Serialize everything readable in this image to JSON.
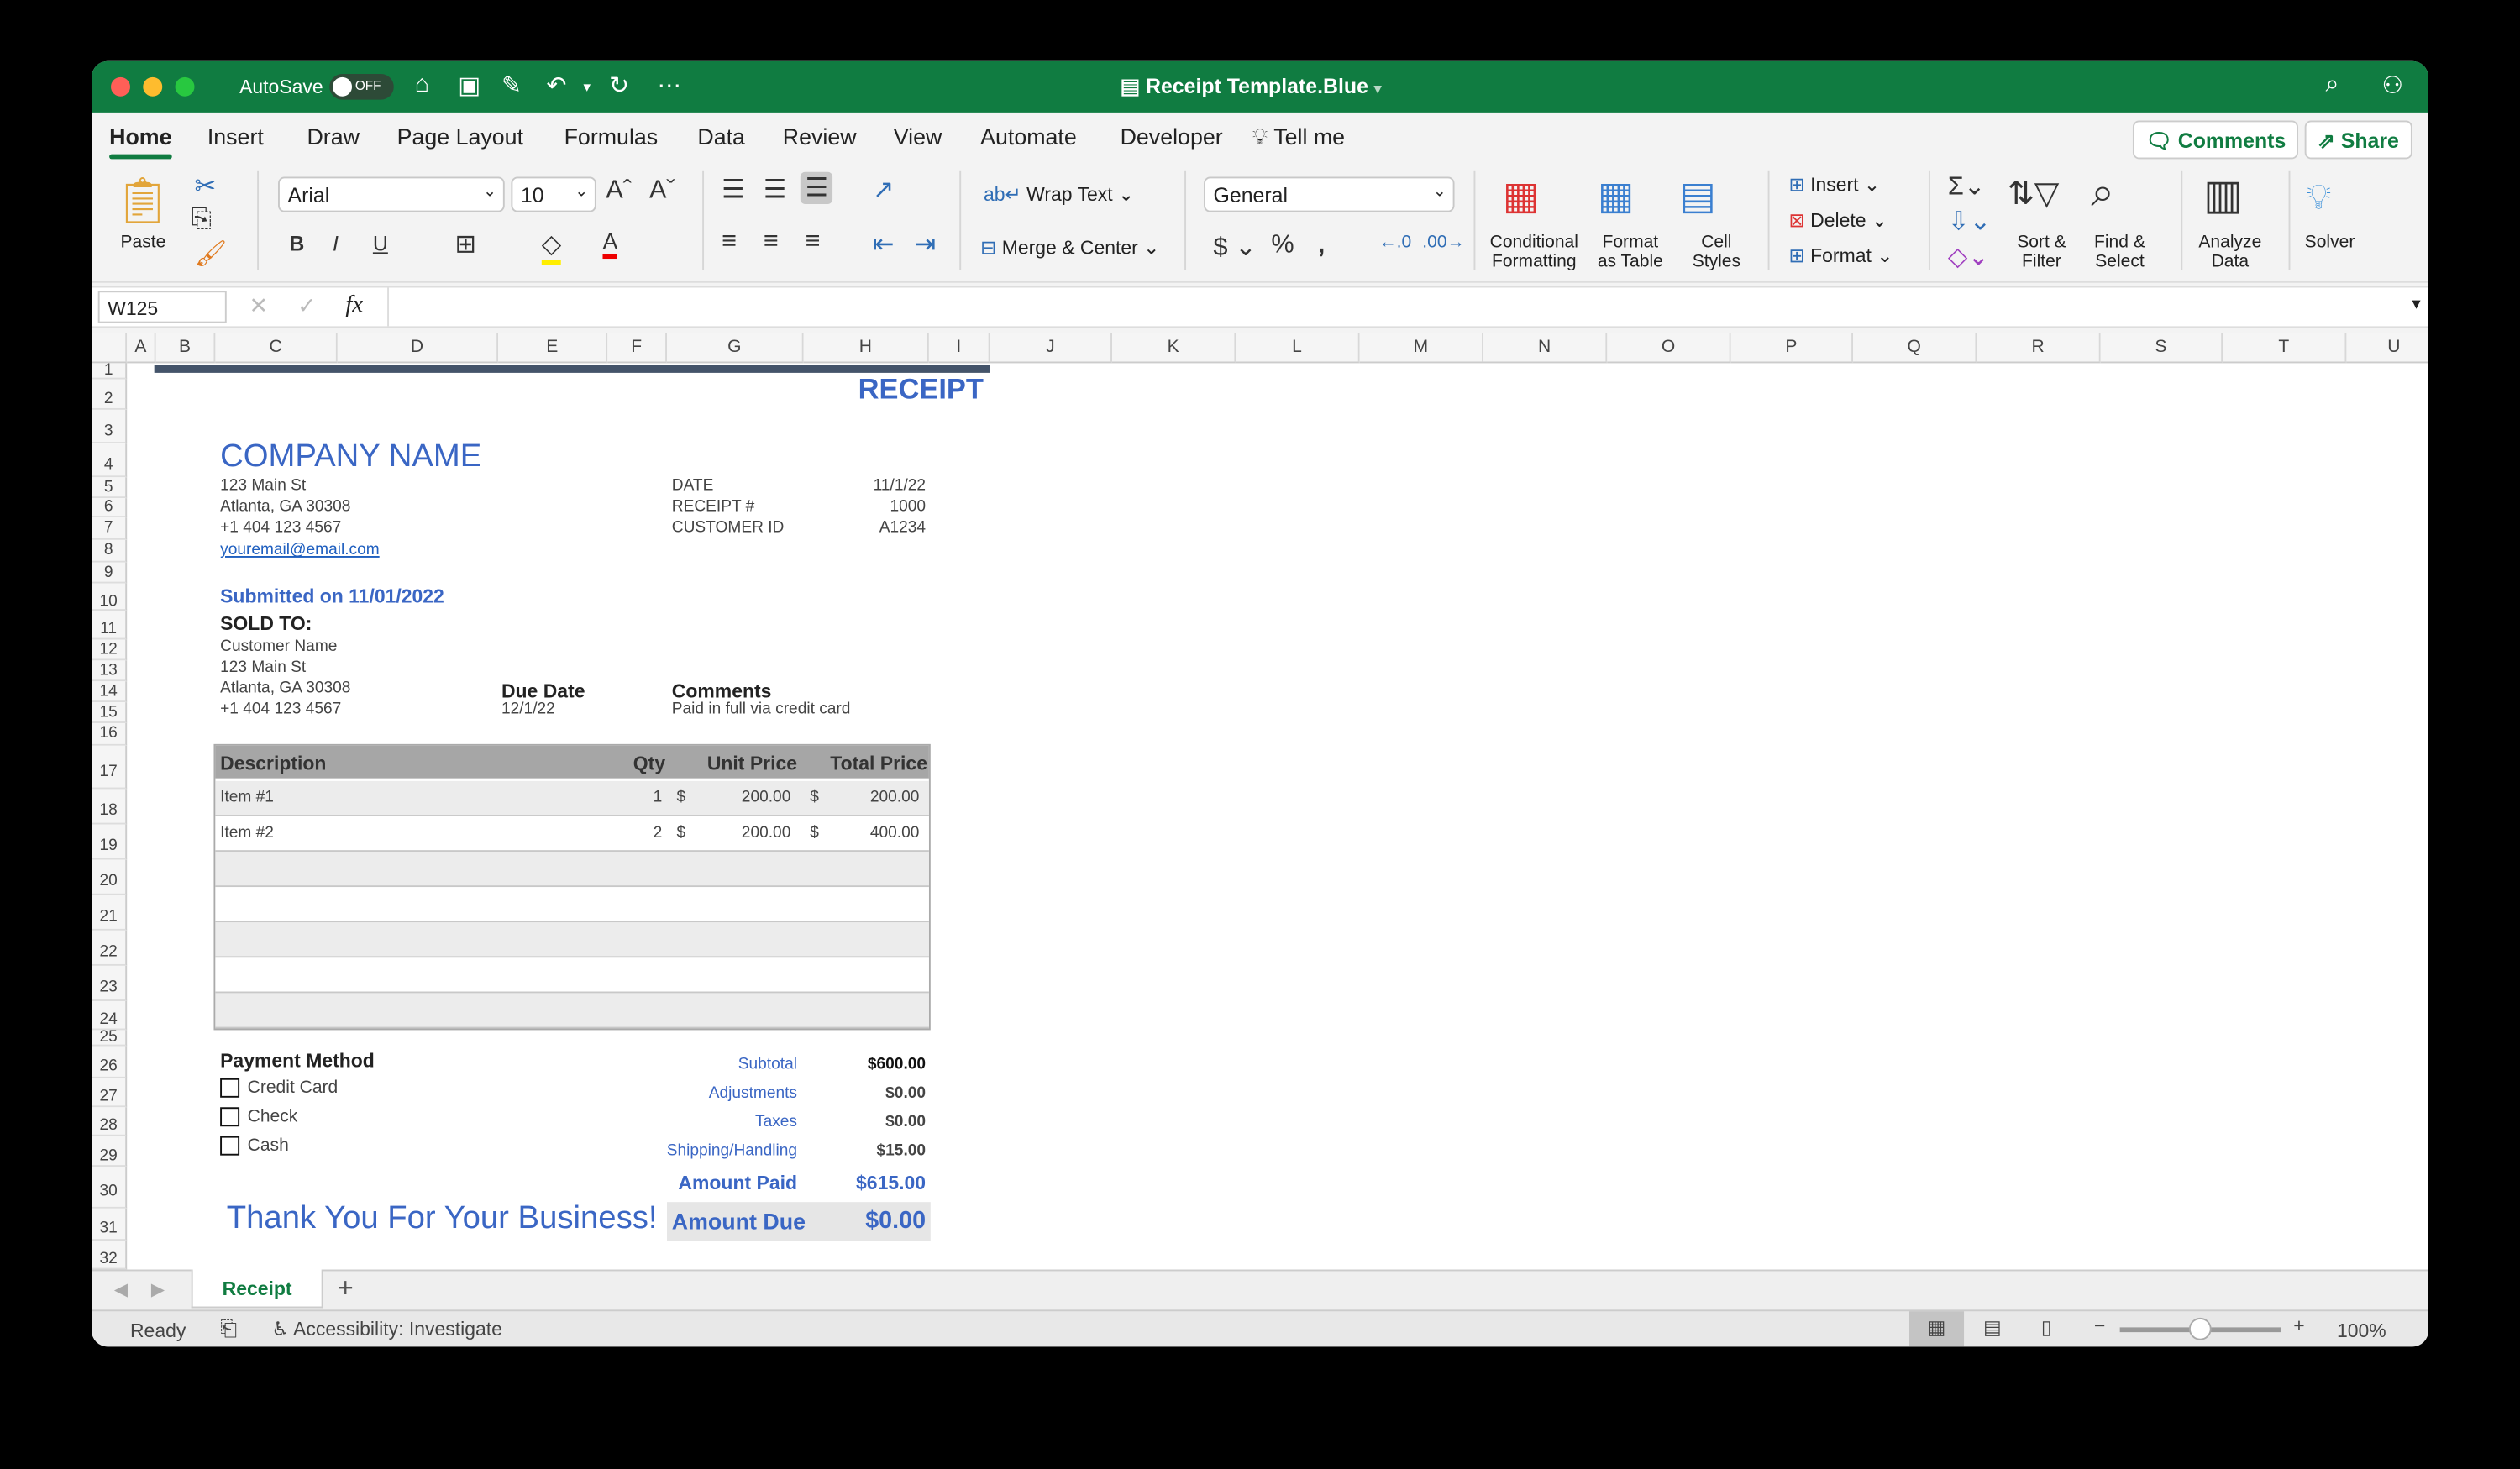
{
  "titlebar": {
    "autosave": "AutoSave",
    "autosave_state": "OFF",
    "doc_title": "Receipt Template.Blue"
  },
  "tabs": [
    "Home",
    "Insert",
    "Draw",
    "Page Layout",
    "Formulas",
    "Data",
    "Review",
    "View",
    "Automate",
    "Developer"
  ],
  "tell_me": "Tell me",
  "comments": "Comments",
  "share": "Share",
  "ribbon": {
    "paste": "Paste",
    "font": "Arial",
    "size": "10",
    "wrap": "Wrap Text",
    "merge": "Merge & Center",
    "numfmt": "General",
    "cond1": "Conditional",
    "cond2": "Formatting",
    "fmt1": "Format",
    "fmt2": "as Table",
    "cs1": "Cell",
    "cs2": "Styles",
    "insert": "Insert",
    "delete": "Delete",
    "format": "Format",
    "sort1": "Sort &",
    "sort2": "Filter",
    "find1": "Find &",
    "find2": "Select",
    "an1": "Analyze",
    "an2": "Data",
    "solver": "Solver",
    "bold": "B",
    "italic": "I",
    "underline": "U"
  },
  "formula_bar": {
    "name_box": "W125",
    "fx": "fx",
    "value": ""
  },
  "columns": [
    "A",
    "B",
    "C",
    "D",
    "E",
    "F",
    "G",
    "H",
    "I",
    "J",
    "K",
    "L",
    "M",
    "N",
    "O",
    "P",
    "Q",
    "R",
    "S",
    "T",
    "U"
  ],
  "rows": [
    "1",
    "2",
    "3",
    "4",
    "5",
    "6",
    "7",
    "8",
    "9",
    "10",
    "11",
    "12",
    "13",
    "14",
    "15",
    "16",
    "17",
    "18",
    "19",
    "20",
    "21",
    "22",
    "23",
    "24",
    "25",
    "26",
    "27",
    "28",
    "29",
    "30",
    "31",
    "32"
  ],
  "receipt": {
    "title": "RECEIPT",
    "company": "COMPANY NAME",
    "addr1": "123 Main St",
    "addr2": "Atlanta, GA 30308",
    "phone": "+1 404 123 4567",
    "email": "youremail@email.com",
    "date_label": "DATE",
    "date": "11/1/22",
    "receipt_label": "RECEIPT #",
    "receipt_no": "1000",
    "cust_label": "CUSTOMER ID",
    "cust_id": "A1234",
    "submitted": "Submitted on 11/01/2022",
    "sold_to": "SOLD TO:",
    "cname": "Customer Name",
    "caddr1": "123 Main St",
    "caddr2": "Atlanta, GA 30308",
    "cphone": "+1 404 123 4567",
    "due_label": "Due Date",
    "due": "12/1/22",
    "comments_label": "Comments",
    "comments": "Paid in full via credit card",
    "headers": {
      "desc": "Description",
      "qty": "Qty",
      "unit": "Unit Price",
      "total": "Total Price"
    },
    "items": [
      {
        "desc": "Item #1",
        "qty": "1",
        "cur": "$",
        "unit": "200.00",
        "cur2": "$",
        "total": "200.00"
      },
      {
        "desc": "Item #2",
        "qty": "2",
        "cur": "$",
        "unit": "200.00",
        "cur2": "$",
        "total": "400.00"
      }
    ],
    "payment_label": "Payment Method",
    "payment": [
      "Credit Card",
      "Check",
      "Cash"
    ],
    "totals": [
      {
        "label": "Subtotal",
        "value": "$600.00"
      },
      {
        "label": "Adjustments",
        "value": "$0.00"
      },
      {
        "label": "Taxes",
        "value": "$0.00"
      },
      {
        "label": "Shipping/Handling",
        "value": "$15.00"
      }
    ],
    "paid_label": "Amount Paid",
    "paid": "$615.00",
    "due_amt_label": "Amount Due",
    "due_amt": "$0.00",
    "thanks": "Thank You For Your Business!"
  },
  "sheet_tab": "Receipt",
  "add_sheet": "+",
  "status": {
    "ready": "Ready",
    "accessibility": "Accessibility: Investigate",
    "zoom": "100%"
  },
  "colors": {
    "brand": "#107c41",
    "accent": "#3a66c4"
  }
}
